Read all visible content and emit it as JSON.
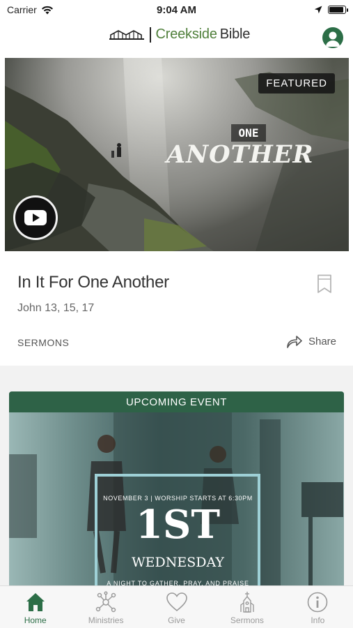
{
  "status_bar": {
    "carrier": "Carrier",
    "time": "9:04 AM",
    "battery_level": 0.9
  },
  "header": {
    "logo_word_a": "Creekside",
    "logo_word_b": "Bible",
    "profile_icon": "person-icon",
    "accent_color": "#2c6e47"
  },
  "featured": {
    "badge": "FEATURED",
    "hero_small_text": "ONE",
    "hero_big_text": "ANOTHER",
    "title": "In It For One Another",
    "subtitle": "John 13, 15, 17",
    "category": "SERMONS",
    "share_label": "Share"
  },
  "event": {
    "header": "UPCOMING EVENT",
    "date_line": "NOVEMBER 3 | WORSHIP STARTS AT 6:30PM",
    "big_text": "1ST",
    "mid_text": "WEDNESDAY",
    "tagline": "A NIGHT TO GATHER, PRAY, AND PRAISE"
  },
  "tabs": [
    {
      "label": "Home",
      "icon": "home-icon",
      "active": true
    },
    {
      "label": "Ministries",
      "icon": "network-icon",
      "active": false
    },
    {
      "label": "Give",
      "icon": "heart-icon",
      "active": false
    },
    {
      "label": "Sermons",
      "icon": "church-icon",
      "active": false
    },
    {
      "label": "Info",
      "icon": "info-icon",
      "active": false
    }
  ]
}
